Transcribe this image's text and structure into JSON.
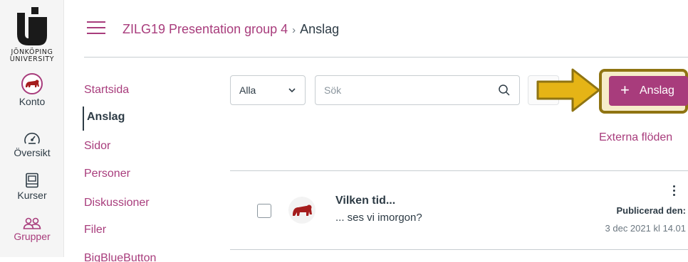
{
  "global_nav": {
    "logo_line1": "JÖNKÖPING",
    "logo_line2": "UNIVERSITY",
    "items": [
      {
        "label": "Konto",
        "icon": "avatar-icon"
      },
      {
        "label": "Översikt",
        "icon": "dashboard-icon"
      },
      {
        "label": "Kurser",
        "icon": "courses-icon"
      },
      {
        "label": "Grupper",
        "icon": "groups-icon"
      }
    ]
  },
  "header": {
    "course": "ZILG19 Presentation group 4",
    "separator": "›",
    "current": "Anslag"
  },
  "course_nav": {
    "items": [
      {
        "label": "Startsida"
      },
      {
        "label": "Anslag"
      },
      {
        "label": "Sidor"
      },
      {
        "label": "Personer"
      },
      {
        "label": "Diskussioner"
      },
      {
        "label": "Filer"
      },
      {
        "label": "BigBlueButton"
      }
    ]
  },
  "toolbar": {
    "filter_value": "Alla",
    "search_placeholder": "Sök",
    "add_button": "Anslag",
    "add_plus": "+",
    "external_feeds": "Externa flöden"
  },
  "announcements": [
    {
      "title": "Vilken tid...",
      "message": "... ses vi imorgon?",
      "published_label": "Publicerad den:",
      "published_date": "3 dec 2021 kl 14.01"
    }
  ],
  "colors": {
    "brand": "#a83c7c",
    "text": "#2d3b45",
    "highlight_fill": "#f6ecc9",
    "highlight_border": "#8f7412",
    "arrow": "#e5b416"
  }
}
